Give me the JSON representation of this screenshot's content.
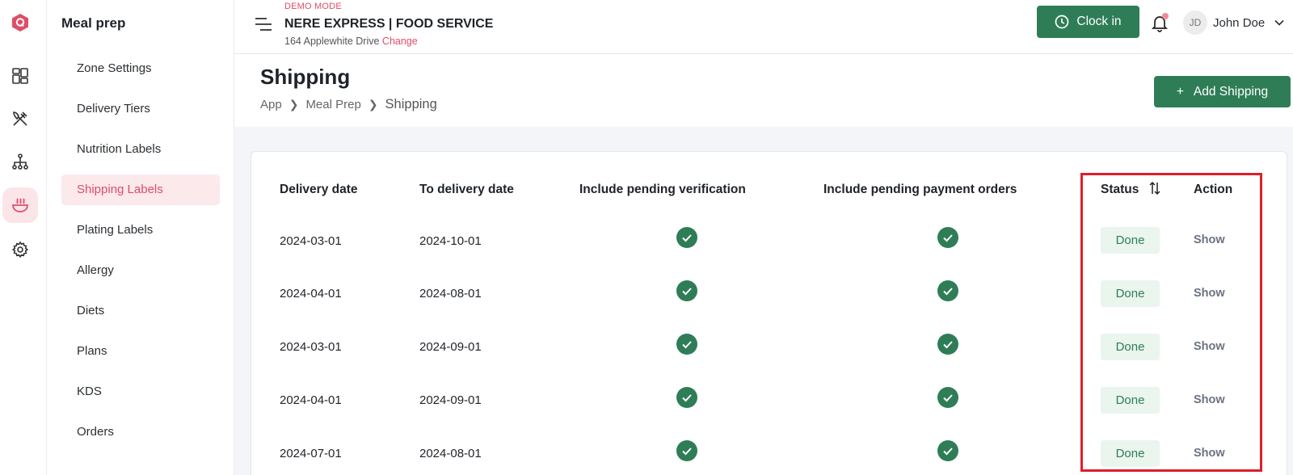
{
  "app": {
    "logo_letter": "Q",
    "accent": "#df4d66",
    "primary": "#2e7d56"
  },
  "rail": {
    "icons": [
      "dashboard-icon",
      "utensils-icon",
      "sitemap-icon",
      "meal-bowl-icon",
      "gear-icon"
    ]
  },
  "sidebar": {
    "title": "Meal prep",
    "items": [
      {
        "label": "Zone Settings"
      },
      {
        "label": "Delivery Tiers"
      },
      {
        "label": "Nutrition Labels"
      },
      {
        "label": "Shipping Labels",
        "active": true
      },
      {
        "label": "Plating Labels"
      },
      {
        "label": "Allergy"
      },
      {
        "label": "Diets"
      },
      {
        "label": "Plans"
      },
      {
        "label": "KDS"
      },
      {
        "label": "Orders"
      }
    ]
  },
  "header": {
    "demo_label": "DEMO MODE",
    "store_name": "NERE EXPRESS | FOOD SERVICE",
    "address": "164 Applewhite Drive",
    "change_label": "Change",
    "clock_label": "Clock in",
    "user_initials": "JD",
    "user_name": "John Doe"
  },
  "page": {
    "title": "Shipping",
    "breadcrumb": [
      "App",
      "Meal Prep",
      "Shipping"
    ],
    "add_button_label": "Add Shipping",
    "add_button_prefix": "+"
  },
  "table": {
    "columns": [
      "Delivery date",
      "To delivery date",
      "Include pending verification",
      "Include pending payment orders",
      "Status",
      "Action"
    ],
    "rows": [
      {
        "delivery_date": "2024-03-01",
        "to_delivery_date": "2024-10-01",
        "pending_verification": true,
        "pending_payment": true,
        "status": "Done",
        "action": "Show"
      },
      {
        "delivery_date": "2024-04-01",
        "to_delivery_date": "2024-08-01",
        "pending_verification": true,
        "pending_payment": true,
        "status": "Done",
        "action": "Show"
      },
      {
        "delivery_date": "2024-03-01",
        "to_delivery_date": "2024-09-01",
        "pending_verification": true,
        "pending_payment": true,
        "status": "Done",
        "action": "Show"
      },
      {
        "delivery_date": "2024-04-01",
        "to_delivery_date": "2024-09-01",
        "pending_verification": true,
        "pending_payment": true,
        "status": "Done",
        "action": "Show"
      },
      {
        "delivery_date": "2024-07-01",
        "to_delivery_date": "2024-08-01",
        "pending_verification": true,
        "pending_payment": true,
        "status": "Done",
        "action": "Show"
      }
    ]
  },
  "highlight_color": "#dc1f2a"
}
